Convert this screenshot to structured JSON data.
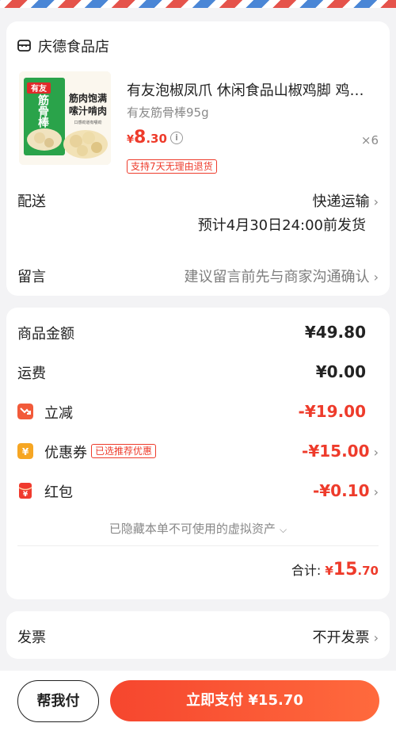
{
  "store": {
    "name": "庆德食品店",
    "icon": "store-icon"
  },
  "product": {
    "title": "有友泡椒凤爪 休闲食品山椒鸡脚 鸡…",
    "spec": "有友筋骨棒95g",
    "price_currency": "¥",
    "price_int": "8",
    "price_dec": ".30",
    "quantity": "×6",
    "return_tag": "支持7天无理由退货",
    "image": {
      "brand": "有友",
      "line1": "筋肉饱满",
      "line2": "嗦汁啃肉",
      "name_v": "筋骨棒",
      "small": "口感劲道有嚼劲"
    }
  },
  "delivery": {
    "label": "配送",
    "method": "快递运输",
    "estimate": "预计4月30日24:00前发货"
  },
  "message": {
    "label": "留言",
    "placeholder": "建议留言前先与商家沟通确认"
  },
  "price": {
    "goods_label": "商品金额",
    "goods_value": "¥49.80",
    "shipping_label": "运费",
    "shipping_value": "¥0.00",
    "reduce_label": "立减",
    "reduce_value": "-¥19.00",
    "coupon_label": "优惠券",
    "coupon_tag": "已选推荐优惠",
    "coupon_value": "-¥15.00",
    "redpacket_label": "红包",
    "redpacket_value": "-¥0.10",
    "hidden_assets": "已隐藏本单不可使用的虚拟资产",
    "total_label": "合计:",
    "total_currency": "¥",
    "total_int": "15",
    "total_dec": ".70"
  },
  "invoice": {
    "label": "发票",
    "value": "不开发票"
  },
  "actions": {
    "help_pay": "帮我付",
    "pay_now": "立即支付 ¥15.70"
  },
  "colors": {
    "accent": "#ee3b2b",
    "pay_button": "#f6462e",
    "background": "#f3f3f5"
  }
}
